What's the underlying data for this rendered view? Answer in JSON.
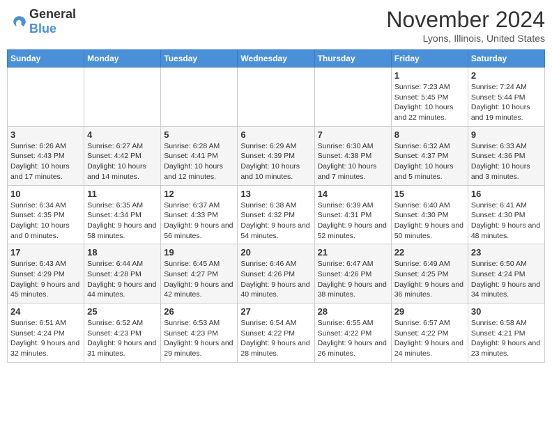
{
  "header": {
    "logo": {
      "text1": "General",
      "text2": "Blue"
    },
    "title": "November 2024",
    "location": "Lyons, Illinois, United States"
  },
  "days_of_week": [
    "Sunday",
    "Monday",
    "Tuesday",
    "Wednesday",
    "Thursday",
    "Friday",
    "Saturday"
  ],
  "weeks": [
    [
      {
        "day": "",
        "info": ""
      },
      {
        "day": "",
        "info": ""
      },
      {
        "day": "",
        "info": ""
      },
      {
        "day": "",
        "info": ""
      },
      {
        "day": "",
        "info": ""
      },
      {
        "day": "1",
        "info": "Sunrise: 7:23 AM\nSunset: 5:45 PM\nDaylight: 10 hours and 22 minutes."
      },
      {
        "day": "2",
        "info": "Sunrise: 7:24 AM\nSunset: 5:44 PM\nDaylight: 10 hours and 19 minutes."
      }
    ],
    [
      {
        "day": "3",
        "info": "Sunrise: 6:26 AM\nSunset: 4:43 PM\nDaylight: 10 hours and 17 minutes."
      },
      {
        "day": "4",
        "info": "Sunrise: 6:27 AM\nSunset: 4:42 PM\nDaylight: 10 hours and 14 minutes."
      },
      {
        "day": "5",
        "info": "Sunrise: 6:28 AM\nSunset: 4:41 PM\nDaylight: 10 hours and 12 minutes."
      },
      {
        "day": "6",
        "info": "Sunrise: 6:29 AM\nSunset: 4:39 PM\nDaylight: 10 hours and 10 minutes."
      },
      {
        "day": "7",
        "info": "Sunrise: 6:30 AM\nSunset: 4:38 PM\nDaylight: 10 hours and 7 minutes."
      },
      {
        "day": "8",
        "info": "Sunrise: 6:32 AM\nSunset: 4:37 PM\nDaylight: 10 hours and 5 minutes."
      },
      {
        "day": "9",
        "info": "Sunrise: 6:33 AM\nSunset: 4:36 PM\nDaylight: 10 hours and 3 minutes."
      }
    ],
    [
      {
        "day": "10",
        "info": "Sunrise: 6:34 AM\nSunset: 4:35 PM\nDaylight: 10 hours and 0 minutes."
      },
      {
        "day": "11",
        "info": "Sunrise: 6:35 AM\nSunset: 4:34 PM\nDaylight: 9 hours and 58 minutes."
      },
      {
        "day": "12",
        "info": "Sunrise: 6:37 AM\nSunset: 4:33 PM\nDaylight: 9 hours and 56 minutes."
      },
      {
        "day": "13",
        "info": "Sunrise: 6:38 AM\nSunset: 4:32 PM\nDaylight: 9 hours and 54 minutes."
      },
      {
        "day": "14",
        "info": "Sunrise: 6:39 AM\nSunset: 4:31 PM\nDaylight: 9 hours and 52 minutes."
      },
      {
        "day": "15",
        "info": "Sunrise: 6:40 AM\nSunset: 4:30 PM\nDaylight: 9 hours and 50 minutes."
      },
      {
        "day": "16",
        "info": "Sunrise: 6:41 AM\nSunset: 4:30 PM\nDaylight: 9 hours and 48 minutes."
      }
    ],
    [
      {
        "day": "17",
        "info": "Sunrise: 6:43 AM\nSunset: 4:29 PM\nDaylight: 9 hours and 45 minutes."
      },
      {
        "day": "18",
        "info": "Sunrise: 6:44 AM\nSunset: 4:28 PM\nDaylight: 9 hours and 44 minutes."
      },
      {
        "day": "19",
        "info": "Sunrise: 6:45 AM\nSunset: 4:27 PM\nDaylight: 9 hours and 42 minutes."
      },
      {
        "day": "20",
        "info": "Sunrise: 6:46 AM\nSunset: 4:26 PM\nDaylight: 9 hours and 40 minutes."
      },
      {
        "day": "21",
        "info": "Sunrise: 6:47 AM\nSunset: 4:26 PM\nDaylight: 9 hours and 38 minutes."
      },
      {
        "day": "22",
        "info": "Sunrise: 6:49 AM\nSunset: 4:25 PM\nDaylight: 9 hours and 36 minutes."
      },
      {
        "day": "23",
        "info": "Sunrise: 6:50 AM\nSunset: 4:24 PM\nDaylight: 9 hours and 34 minutes."
      }
    ],
    [
      {
        "day": "24",
        "info": "Sunrise: 6:51 AM\nSunset: 4:24 PM\nDaylight: 9 hours and 32 minutes."
      },
      {
        "day": "25",
        "info": "Sunrise: 6:52 AM\nSunset: 4:23 PM\nDaylight: 9 hours and 31 minutes."
      },
      {
        "day": "26",
        "info": "Sunrise: 6:53 AM\nSunset: 4:23 PM\nDaylight: 9 hours and 29 minutes."
      },
      {
        "day": "27",
        "info": "Sunrise: 6:54 AM\nSunset: 4:22 PM\nDaylight: 9 hours and 28 minutes."
      },
      {
        "day": "28",
        "info": "Sunrise: 6:55 AM\nSunset: 4:22 PM\nDaylight: 9 hours and 26 minutes."
      },
      {
        "day": "29",
        "info": "Sunrise: 6:57 AM\nSunset: 4:22 PM\nDaylight: 9 hours and 24 minutes."
      },
      {
        "day": "30",
        "info": "Sunrise: 6:58 AM\nSunset: 4:21 PM\nDaylight: 9 hours and 23 minutes."
      }
    ]
  ]
}
